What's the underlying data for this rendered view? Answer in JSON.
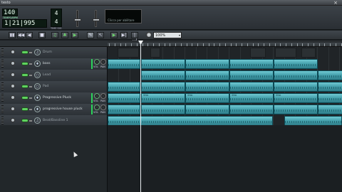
{
  "window": {
    "title": "testo",
    "close_glyph": "×"
  },
  "transport": {
    "tempo_value": "140",
    "tempo_label": "TEMPO/BPM",
    "time_display": "1|21|995",
    "time_sig_num": "4",
    "time_sig_den": "4",
    "time_sig_label": "TIME SIG",
    "cpu_hint": "Clicca per abilitare"
  },
  "toolbar": {
    "buttons": [
      "▮▮",
      "◀◀",
      "◀",
      "■",
      "♫",
      "♣",
      "▶",
      "✎",
      "↖",
      "▶",
      "▶|",
      "|↔|"
    ],
    "zoom_value": "100%",
    "zoom_arrow": "▾"
  },
  "tracks": [
    {
      "name": "Drum",
      "icon": "♫",
      "has_vol": false,
      "dim": true
    },
    {
      "name": "bass",
      "icon": "♦",
      "has_vol": true,
      "dim": false
    },
    {
      "name": "Lead",
      "icon": "○",
      "has_vol": false,
      "dim": true
    },
    {
      "name": "Pad",
      "icon": "○",
      "has_vol": false,
      "dim": true
    },
    {
      "name": "Progressive Pluck",
      "icon": "♦",
      "has_vol": true,
      "dim": false
    },
    {
      "name": "progressive house pluck",
      "icon": "♦",
      "has_vol": true,
      "dim": false
    },
    {
      "name": "Beat/Bassline 1",
      "icon": "♫",
      "has_vol": false,
      "dim": true
    }
  ],
  "knob_labels": {
    "vol": "VOL",
    "pan": "PAN"
  },
  "clip_labels": {
    "a": "SNA",
    "b": "SNA"
  },
  "colors": {
    "clip": "#4fb0bc",
    "mute_led": "#5fd35f",
    "vol_led": "#2bd45b"
  }
}
